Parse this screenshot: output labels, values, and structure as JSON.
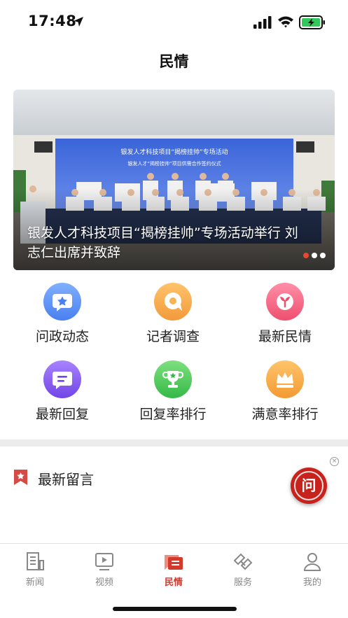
{
  "status_bar": {
    "time": "17:48"
  },
  "header": {
    "title": "民情"
  },
  "banner": {
    "caption": "银发人才科技项目“揭榜挂帅”专场活动举行 刘志仁出席并致辞",
    "screen_title": "银发人才科技项目“揭榜挂帅”专场活动",
    "screen_subtitle": "银发人才“揭榜挂帅”项目供需合作签约仪式",
    "slide_count": 3,
    "active_slide": 1
  },
  "grid": [
    {
      "label": "问政动态",
      "icon": "star-chat-icon",
      "color_top": "#7fb0ff",
      "color_bottom": "#4a7ff0"
    },
    {
      "label": "记者调查",
      "icon": "chat-bubble-icon",
      "color_top": "#ffc36b",
      "color_bottom": "#f29a3b"
    },
    {
      "label": "最新民情",
      "icon": "sprout-icon",
      "color_top": "#ff8fa8",
      "color_bottom": "#ee4f6e"
    },
    {
      "label": "最新回复",
      "icon": "reply-message-icon",
      "color_top": "#a784ff",
      "color_bottom": "#7245e6"
    },
    {
      "label": "回复率排行",
      "icon": "trophy-icon",
      "color_top": "#7ee07f",
      "color_bottom": "#34b947"
    },
    {
      "label": "满意率排行",
      "icon": "crown-icon",
      "color_top": "#ffc46b",
      "color_bottom": "#f39a32"
    }
  ],
  "latest": {
    "title": "最新留言"
  },
  "float_button": {
    "label": "问",
    "close": "×"
  },
  "tab_bar": {
    "tabs": [
      {
        "label": "新闻",
        "icon": "news-icon"
      },
      {
        "label": "视频",
        "icon": "video-icon"
      },
      {
        "label": "民情",
        "icon": "public-opinion-icon"
      },
      {
        "label": "服务",
        "icon": "service-icon"
      },
      {
        "label": "我的",
        "icon": "profile-icon"
      }
    ],
    "active_index": 2
  },
  "colors": {
    "accent": "#d23a2e",
    "inactive": "#888888"
  }
}
